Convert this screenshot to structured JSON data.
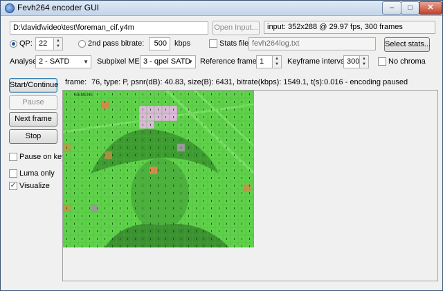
{
  "window": {
    "title": "Fevh264 encoder GUI"
  },
  "input": {
    "path": "D:\\david\\video\\test\\foreman_cif.y4m",
    "open_label": "Open Input...",
    "info": "input: 352x288 @ 29.97 fps, 300 frames"
  },
  "rate": {
    "qp_label": "QP:",
    "qp_value": "22",
    "bitrate_label": "2nd pass bitrate:",
    "bitrate_value": "500",
    "bitrate_unit": "kbps",
    "stats_file_label": "Stats file:",
    "stats_file_value": "fevh264log.txt",
    "select_stats_label": "Select stats..."
  },
  "options": {
    "analyse_label": "Analyse:",
    "analyse_value": "2 - SATD",
    "subpixel_label": "Subpixel ME:",
    "subpixel_value": "3 - qpel SATD",
    "ref_label": "Reference frames:",
    "ref_value": "1",
    "keyint_label": "Keyframe interval:",
    "keyint_value": "300",
    "no_chroma_label": "No chroma"
  },
  "controls": {
    "start": "Start/Continue",
    "pause": "Pause",
    "next": "Next frame",
    "stop": "Stop",
    "pause_on_key": "Pause on key",
    "luma_only": "Luma only",
    "visualize": "Visualize"
  },
  "status": {
    "frame_label": "frame:",
    "frame_info": "76, type: P, psnr(dB): 40.83, size(B): 6431, bitrate(kbps): 1549.1, t(s):0.016 - encoding paused"
  },
  "preview": {
    "watermark": "SIEMENS"
  },
  "colors": {
    "overlay": "#5fd14a",
    "block_pink": "#f0b4f0",
    "block_orange": "#e0844a",
    "block_gray": "#9a9a9a"
  }
}
